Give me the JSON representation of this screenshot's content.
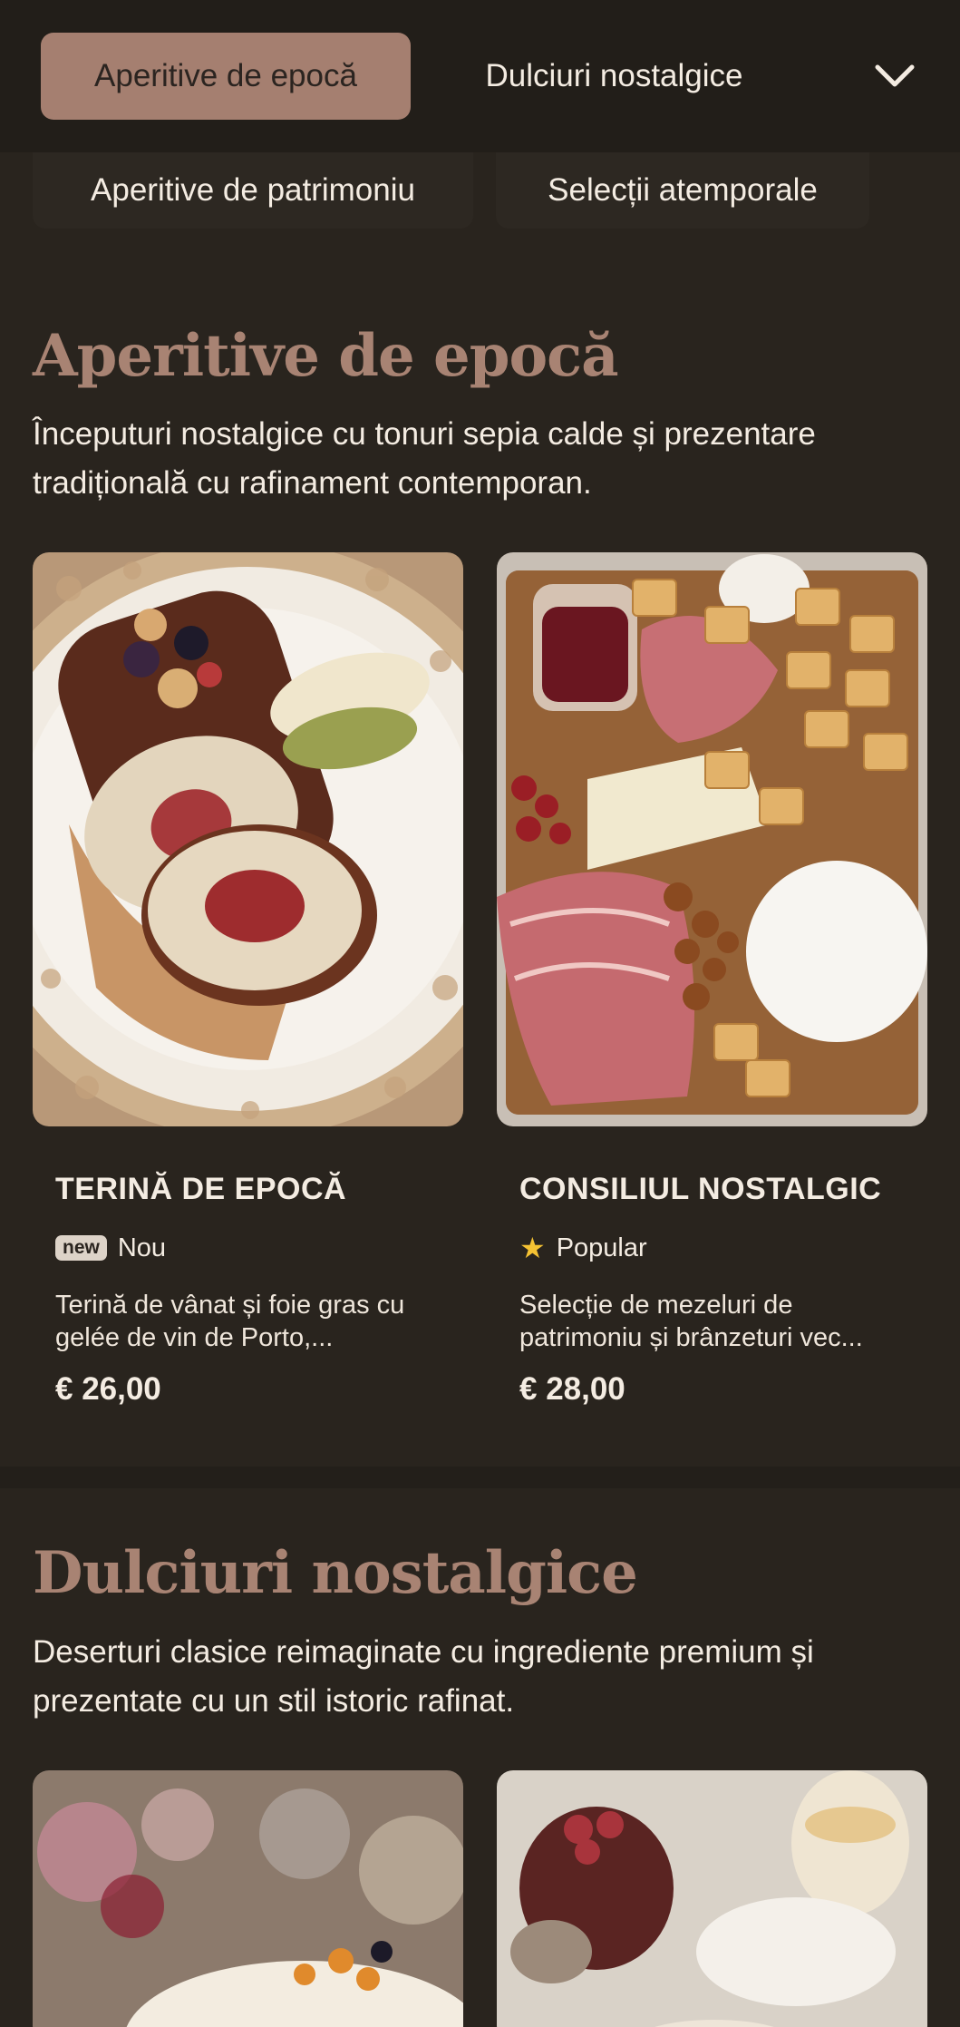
{
  "category_nav": {
    "tabs": [
      {
        "label": "Aperitive de epocă",
        "active": true
      },
      {
        "label": "Dulciuri nostalgice",
        "active": false
      },
      {
        "label": "Aperitive de patrimoniu",
        "active": false
      },
      {
        "label": "Selecții atemporale",
        "active": false
      }
    ],
    "expand_icon": "chevron-down-icon"
  },
  "sections": [
    {
      "title": "Aperitive de epocă",
      "description": "Începuturi nostalgice cu tonuri sepia calde și prezentare tradițională cu rafinament contemporan.",
      "items": [
        {
          "name": "TERINĂ DE EPOCĂ",
          "badge_pill": "new",
          "badge_label": "Nou",
          "description": "Terină de vânat și foie gras cu gelée de vin de Porto,...",
          "price": "€ 26,00",
          "image_subject": "terrine roulade on ornate plate"
        },
        {
          "name": "CONSILIUL NOSTALGIC",
          "badge_icon": "star-icon",
          "badge_label": "Popular",
          "description": "Selecție de mezeluri de patrimoniu și brânzeturi vec...",
          "price": "€ 28,00",
          "image_subject": "charcuterie board with cheese and crackers"
        }
      ]
    },
    {
      "title": "Dulciuri nostalgice",
      "description": "Deserturi clasice reimaginate cu ingrediente premium și prezentate cu un stil istoric rafinat.",
      "items": [
        {
          "image_subject": "cake with fruit and flowers"
        },
        {
          "image_subject": "cherries in a jar with desserts"
        }
      ]
    }
  ],
  "colors": {
    "background": "#29241e",
    "active_tab": "#a57f70",
    "section_title": "#a88373",
    "star": "#f5c233"
  }
}
